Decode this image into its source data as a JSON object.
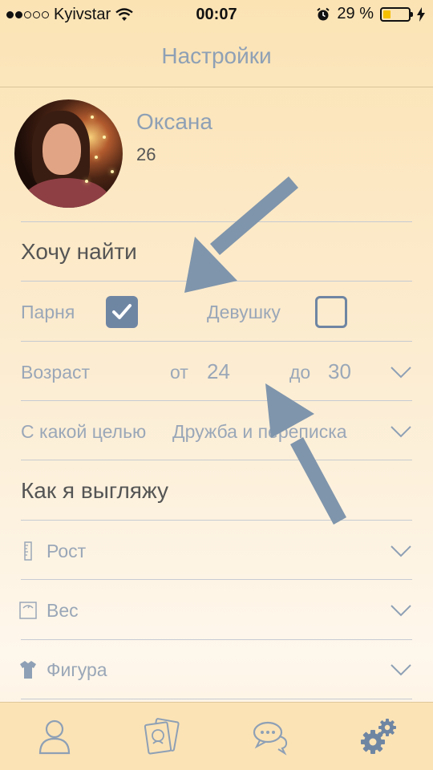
{
  "status_bar": {
    "carrier": "Kyivstar",
    "time": "00:07",
    "battery_percent": "29 %",
    "battery_level": 0.29,
    "signal_bars_filled": 2,
    "signal_bars_total": 5
  },
  "nav": {
    "title": "Настройки"
  },
  "profile": {
    "name": "Оксана",
    "age": "26"
  },
  "looking_for": {
    "heading": "Хочу найти",
    "male_label": "Парня",
    "male_checked": true,
    "female_label": "Девушку",
    "female_checked": false
  },
  "age_range": {
    "label": "Возраст",
    "from_label": "от",
    "from_value": "24",
    "to_label": "до",
    "to_value": "30"
  },
  "purpose": {
    "label": "С какой целью",
    "value": "Дружба и переписка"
  },
  "appearance": {
    "heading": "Как я выгляжу",
    "items": [
      {
        "label": "Рост",
        "icon": "ruler-icon"
      },
      {
        "label": "Вес",
        "icon": "scale-icon"
      },
      {
        "label": "Фигура",
        "icon": "shirt-icon"
      }
    ]
  },
  "tab_bar": {
    "items": [
      "profile-icon",
      "cards-icon",
      "chat-icon",
      "settings-icon"
    ],
    "active": "settings-icon"
  },
  "colors": {
    "accent": "#6f86a3",
    "muted_text": "#9aa7b8",
    "arrow": "#7f95ac"
  }
}
